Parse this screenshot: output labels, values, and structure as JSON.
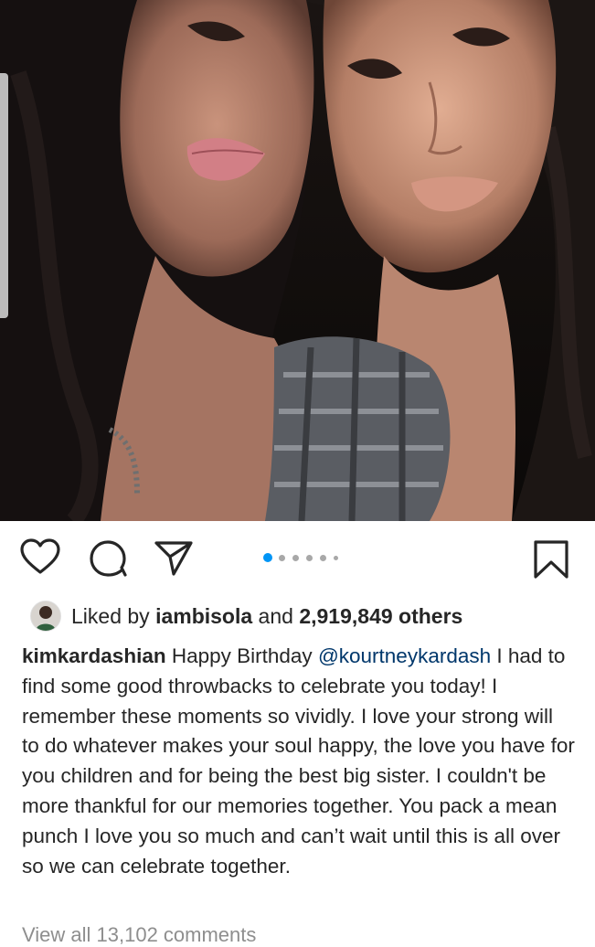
{
  "post": {
    "image": {
      "description_icon": "photo",
      "slide_count": 6,
      "active_slide": 1
    },
    "actions": {
      "like_icon": "heart-icon",
      "comment_icon": "comment-icon",
      "share_icon": "paper-plane-icon",
      "save_icon": "bookmark-icon"
    },
    "likes": {
      "prefix": "Liked by ",
      "user": "iambisola",
      "joiner": " and ",
      "count": "2,919,849 others"
    },
    "caption": {
      "username": "kimkardashian",
      "text_before_mention": "Happy Birthday ",
      "mention": "@kourtneykardash",
      "text_after_mention": " I had to find some good throwbacks to celebrate you today! I remember these moments so vividly. I love your strong will to do whatever makes your soul happy, the love you have for you children and for being the best big sister. I couldn't be more thankful for our memories together. You pack a mean punch I love you so much and can’t wait until this is all over so we can celebrate together."
    },
    "comments": {
      "view_all": "View all 13,102 comments"
    },
    "colors": {
      "accent": "#0095f6",
      "text": "#262626",
      "mention": "#00376b",
      "muted": "#8e8e8e"
    }
  }
}
